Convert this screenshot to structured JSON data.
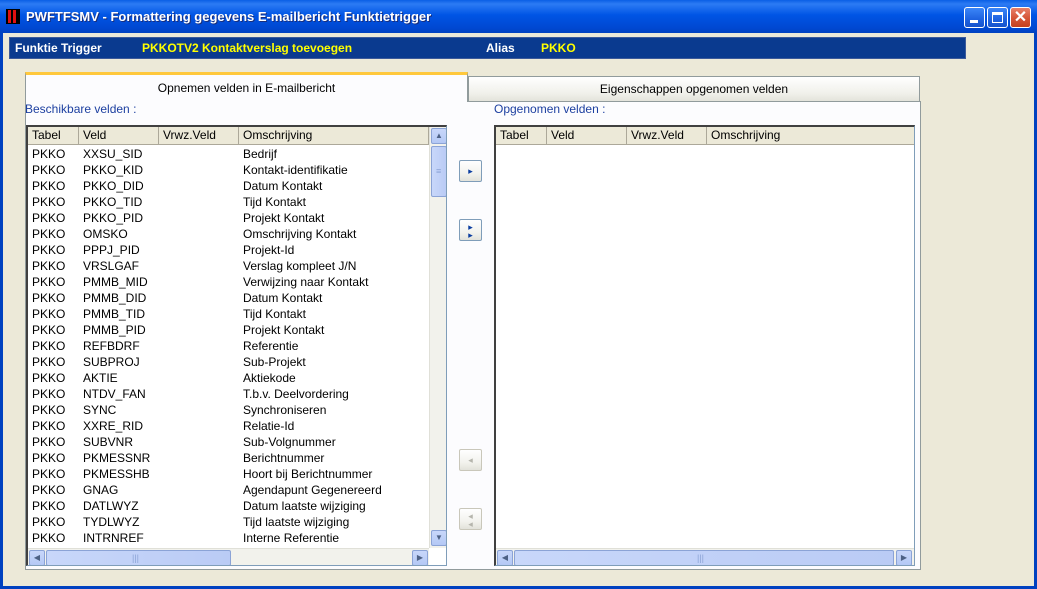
{
  "window": {
    "title": "PWFTFSMV - Formattering gegevens E-mailbericht Funktietrigger"
  },
  "colors": {
    "titlebar": "#0055E5",
    "infobar": "#0A3A8F",
    "info_label": "#FFFFFF",
    "info_value": "#FFFF00",
    "tab_highlight": "#FFC83C",
    "section_label": "#1C3FA0",
    "button_arrow": "#0A3DA0"
  },
  "icons": {
    "app": "app-icon",
    "minimize": "minimize-icon",
    "maximize": "maximize-icon",
    "close": "close-icon",
    "add": "arrow-right-icon",
    "add_all": "double-arrow-right-icon",
    "remove": "arrow-left-icon",
    "remove_all": "double-arrow-left-icon"
  },
  "info": {
    "trigger_label": "Funktie Trigger",
    "trigger_value": "PKKOTV2  Kontaktverslag toevoegen",
    "alias_label": "Alias",
    "alias_value": "PKKO"
  },
  "tabs": [
    {
      "label": "Opnemen velden in E-mailbericht",
      "active": true
    },
    {
      "label": "Eigenschappen opgenomen velden",
      "active": false
    }
  ],
  "available": {
    "label": "Beschikbare velden :",
    "columns": [
      "Tabel",
      "Veld",
      "Vrwz.Veld",
      "Omschrijving"
    ],
    "rows": [
      [
        "PKKO",
        "XXSU_SID",
        "",
        "Bedrijf"
      ],
      [
        "PKKO",
        "PKKO_KID",
        "",
        "Kontakt-identifikatie"
      ],
      [
        "PKKO",
        "PKKO_DID",
        "",
        "Datum Kontakt"
      ],
      [
        "PKKO",
        "PKKO_TID",
        "",
        "Tijd Kontakt"
      ],
      [
        "PKKO",
        "PKKO_PID",
        "",
        "Projekt Kontakt"
      ],
      [
        "PKKO",
        "OMSKO",
        "",
        "Omschrijving Kontakt"
      ],
      [
        "PKKO",
        "PPPJ_PID",
        "",
        "Projekt-Id"
      ],
      [
        "PKKO",
        "VRSLGAF",
        "",
        "Verslag kompleet J/N"
      ],
      [
        "PKKO",
        "PMMB_MID",
        "",
        "Verwijzing naar Kontakt"
      ],
      [
        "PKKO",
        "PMMB_DID",
        "",
        "Datum Kontakt"
      ],
      [
        "PKKO",
        "PMMB_TID",
        "",
        "Tijd Kontakt"
      ],
      [
        "PKKO",
        "PMMB_PID",
        "",
        "Projekt Kontakt"
      ],
      [
        "PKKO",
        "REFBDRF",
        "",
        "Referentie"
      ],
      [
        "PKKO",
        "SUBPROJ",
        "",
        "Sub-Projekt"
      ],
      [
        "PKKO",
        "AKTIE",
        "",
        "Aktiekode"
      ],
      [
        "PKKO",
        "NTDV_FAN",
        "",
        "T.b.v. Deelvordering"
      ],
      [
        "PKKO",
        "SYNC",
        "",
        "Synchroniseren"
      ],
      [
        "PKKO",
        "XXRE_RID",
        "",
        "Relatie-Id"
      ],
      [
        "PKKO",
        "SUBVNR",
        "",
        "Sub-Volgnummer"
      ],
      [
        "PKKO",
        "PKMESSNR",
        "",
        "Berichtnummer"
      ],
      [
        "PKKO",
        "PKMESSHB",
        "",
        "Hoort bij Berichtnummer"
      ],
      [
        "PKKO",
        "GNAG",
        "",
        "Agendapunt Gegenereerd"
      ],
      [
        "PKKO",
        "DATLWYZ",
        "",
        "Datum laatste wijziging"
      ],
      [
        "PKKO",
        "TYDLWYZ",
        "",
        "Tijd laatste wijziging"
      ],
      [
        "PKKO",
        "INTRNREF",
        "",
        "Interne Referentie"
      ]
    ]
  },
  "included": {
    "label": "Opgenomen velden :",
    "columns": [
      "Tabel",
      "Veld",
      "Vrwz.Veld",
      "Omschrijving"
    ],
    "rows": []
  },
  "buttons": {
    "add_glyph": "▸",
    "add_all_glyph_top": "▸",
    "add_all_glyph_bottom": "▸",
    "remove_glyph": "◂",
    "remove_all_glyph_top": "◂",
    "remove_all_glyph_bottom": "◂"
  },
  "scroll_glyphs": {
    "up": "▲",
    "down": "▼",
    "left": "◀",
    "right": "▶",
    "grip_v": "≡",
    "grip_h": "|||"
  }
}
